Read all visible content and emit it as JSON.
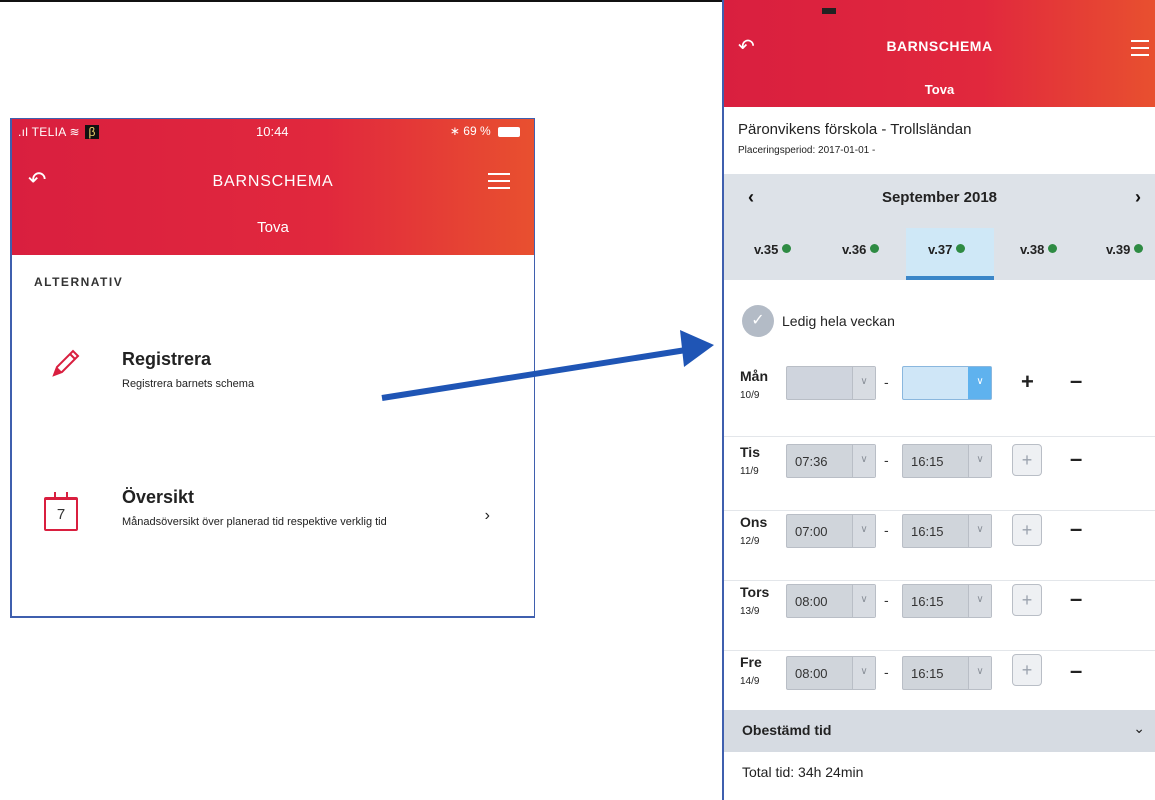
{
  "left_screen": {
    "status": {
      "carrier": "TELIA",
      "beta": "β",
      "time": "10:44",
      "battery": "69 %"
    },
    "header": {
      "title": "BARNSCHEMA",
      "subtitle": "Tova"
    },
    "section_label": "ALTERNATIV",
    "options": [
      {
        "title": "Registrera",
        "description": "Registrera barnets schema",
        "icon": "pencil-icon"
      },
      {
        "title": "Översikt",
        "description": "Månadsöversikt över planerad tid respektive verklig tid",
        "icon": "calendar-icon",
        "calendar_day": "7"
      }
    ],
    "colors": {
      "header_red": "#d91f3f",
      "accent": "#e8502f"
    }
  },
  "arrow": {
    "color": "#1f55b5"
  },
  "right_screen": {
    "header": {
      "title": "BARNSCHEMA",
      "subtitle": "Tova"
    },
    "school": "Päronvikens förskola - Trollsländan",
    "period": "Placeringsperiod: 2017-01-01 -",
    "month": "September 2018",
    "weeks": [
      {
        "label": "v.35",
        "ok": true
      },
      {
        "label": "v.36",
        "ok": true
      },
      {
        "label": "v.37",
        "ok": true,
        "selected": true
      },
      {
        "label": "v.38",
        "ok": true
      },
      {
        "label": "v.39",
        "ok": true
      }
    ],
    "ledig_label": "Ledig hela veckan",
    "days": [
      {
        "name": "Mån",
        "date": "10/9",
        "start": "",
        "end": ""
      },
      {
        "name": "Tis",
        "date": "11/9",
        "start": "07:36",
        "end": "16:15"
      },
      {
        "name": "Ons",
        "date": "12/9",
        "start": "07:00",
        "end": "16:15"
      },
      {
        "name": "Tors",
        "date": "13/9",
        "start": "08:00",
        "end": "16:15"
      },
      {
        "name": "Fre",
        "date": "14/9",
        "start": "08:00",
        "end": "16:15"
      }
    ],
    "obestamd_label": "Obestämd tid",
    "total": "Total tid: 34h 24min"
  }
}
